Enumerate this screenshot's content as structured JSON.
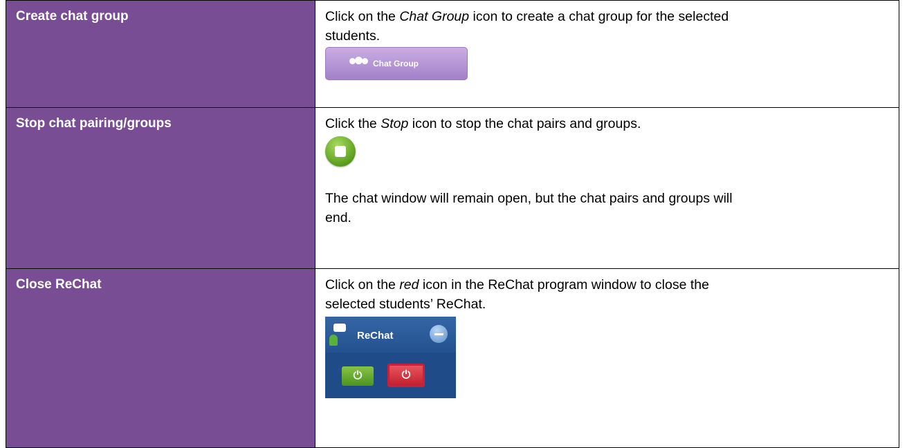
{
  "rows": [
    {
      "label": "Create chat group",
      "desc_pre": "Click on the ",
      "desc_em": "Chat Group",
      "desc_post": " icon to create a chat group for the selected",
      "desc_line2": "students.",
      "button_label": "Chat Group",
      "button_icon": "chat-group-icon"
    },
    {
      "label": "Stop chat pairing/groups",
      "desc_pre": "Click the ",
      "desc_em": "Stop",
      "desc_post": " icon to stop the chat pairs and groups.",
      "icon": "stop-icon",
      "note_line1": "The chat window will remain open, but the chat pairs and groups will",
      "note_line2": "end."
    },
    {
      "label": "Close ReChat",
      "desc_pre": "Click on the ",
      "desc_em": "red",
      "desc_post": " icon in the ReChat program window to close the",
      "desc_line2": "selected students’ ReChat.",
      "widget_title": "ReChat",
      "power_glyph": "⏻"
    }
  ],
  "colors": {
    "label_bg": "#784d94",
    "label_text": "#ffffff",
    "chat_button": "#b596d6",
    "stop_green": "#5b9e1e",
    "rechat_bg": "#1f4b88",
    "power_green": "#6aaf33",
    "power_red": "#d83a45"
  }
}
